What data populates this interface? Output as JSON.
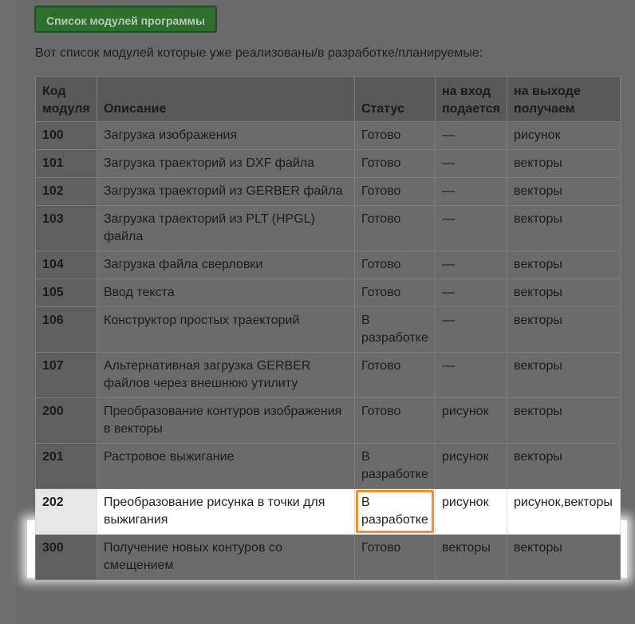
{
  "button": {
    "label": "Список модулей программы"
  },
  "intro": "Вот список модулей которые уже реализованы/в разработке/планируемые:",
  "table": {
    "headers": {
      "code": "Код модуля",
      "description": "Описание",
      "status": "Статус",
      "input": "на вход подается",
      "output": "на выходе получаем"
    },
    "rows": [
      {
        "code": "100",
        "description": "Загрузка изображения",
        "status": "Готово",
        "input": "—",
        "output": "рисунок"
      },
      {
        "code": "101",
        "description": "Загрузка траекторий из DXF файла",
        "status": "Готово",
        "input": "—",
        "output": "векторы"
      },
      {
        "code": "102",
        "description": "Загрузка траекторий из GERBER файла",
        "status": "Готово",
        "input": "—",
        "output": "векторы"
      },
      {
        "code": "103",
        "description": "Загрузка траекторий из PLT (HPGL) файла",
        "status": "Готово",
        "input": "—",
        "output": "векторы"
      },
      {
        "code": "104",
        "description": "Загрузка файла сверловки",
        "status": "Готово",
        "input": "—",
        "output": "векторы"
      },
      {
        "code": "105",
        "description": "Ввод текста",
        "status": "Готово",
        "input": "—",
        "output": "векторы"
      },
      {
        "code": "106",
        "description": "Конструктор простых траекторий",
        "status": "В разработке",
        "input": "—",
        "output": "векторы"
      },
      {
        "code": "107",
        "description": "Альтернативная загрузка GERBER файлов через внешнюю утилиту",
        "status": "Готово",
        "input": "—",
        "output": "векторы"
      },
      {
        "code": "200",
        "description": "Преобразование контуров изображения в векторы",
        "status": "Готово",
        "input": "рисунок",
        "output": "векторы"
      },
      {
        "code": "201",
        "description": "Растровое выжигание",
        "status": "В разработке",
        "input": "рисунок",
        "output": "векторы"
      },
      {
        "code": "202",
        "description": "Преобразование рисунка в точки для выжигания",
        "status": "В разработке",
        "input": "рисунок",
        "output": "рисунок,векторы",
        "highlighted": true
      },
      {
        "code": "300",
        "description": "Получение новых контуров со смещением",
        "status": "Готово",
        "input": "векторы",
        "output": "векторы"
      }
    ]
  }
}
